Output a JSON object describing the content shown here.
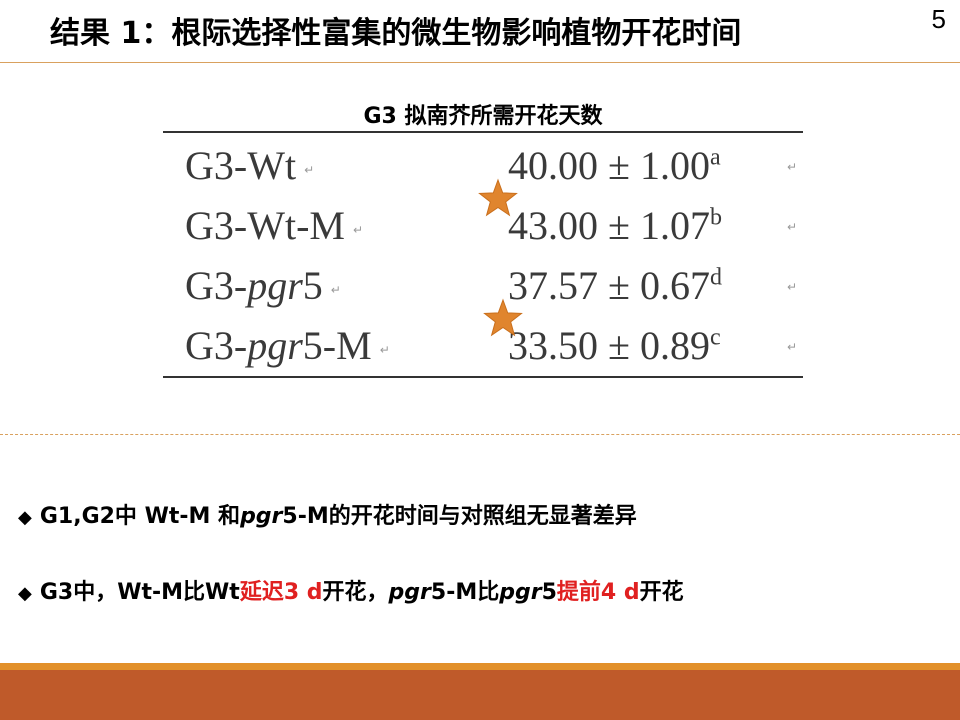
{
  "header": {
    "title": "结果 1：根际选择性富集的微生物影响植物开花时间",
    "page_number": "5"
  },
  "table": {
    "caption": "G3 拟南芥所需开花天数",
    "rows": [
      {
        "name_pre": "G3-Wt",
        "name_italic": "",
        "name_post": "",
        "mean": "40.00",
        "pm": "±",
        "sd": "1.00",
        "letter": "a",
        "starred": false
      },
      {
        "name_pre": "G3-Wt-M",
        "name_italic": "",
        "name_post": "",
        "mean": "43.00",
        "pm": "±",
        "sd": "1.07",
        "letter": "b",
        "starred": true
      },
      {
        "name_pre": "G3-",
        "name_italic": "pgr",
        "name_post": "5",
        "mean": "37.57",
        "pm": "±",
        "sd": "0.67",
        "letter": "d",
        "starred": false
      },
      {
        "name_pre": "G3-",
        "name_italic": "pgr",
        "name_post": "5-M",
        "mean": "33.50",
        "pm": "±",
        "sd": "0.89",
        "letter": "c",
        "starred": true
      }
    ],
    "para_mark": "↵"
  },
  "star_color": "#e0852e",
  "accent_colors": {
    "red": "#e02020",
    "bar_orange": "#e2902a",
    "bar_rust": "#bf5a2a"
  },
  "bullets": {
    "symbol": "◆",
    "b1": {
      "t1": "G1,G2中 Wt-M 和",
      "t2": "pgr",
      "t3": "5-M的开花时间与对照组无显著差异"
    },
    "b2": {
      "t1": "G3中，Wt-M比Wt",
      "t2": "延迟3 d",
      "t3": "开花，",
      "t4": "pgr",
      "t5": "5-M比",
      "t6": "pgr",
      "t7": "5",
      "t8": "提前4 d",
      "t9": "开花"
    }
  }
}
